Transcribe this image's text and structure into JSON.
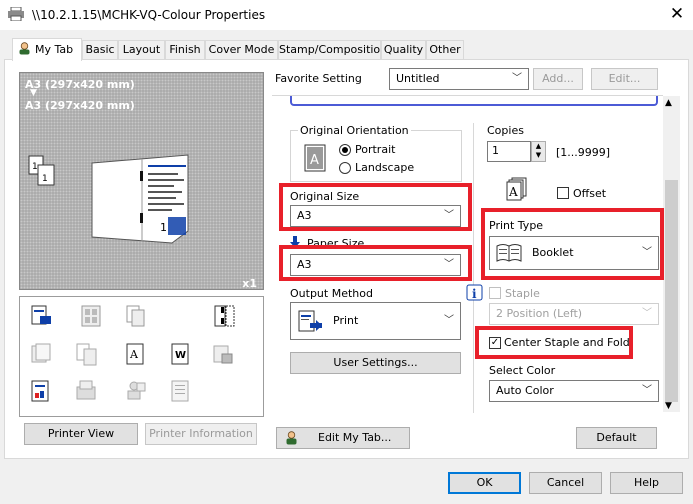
{
  "window": {
    "title": "\\\\10.2.1.15\\MCHK-VQ-Colour Properties",
    "close_glyph": "✕"
  },
  "tabs": [
    {
      "label": "My Tab"
    },
    {
      "label": "Basic"
    },
    {
      "label": "Layout"
    },
    {
      "label": "Finish"
    },
    {
      "label": "Cover Mode"
    },
    {
      "label": "Stamp/Composition"
    },
    {
      "label": "Quality"
    },
    {
      "label": "Other"
    }
  ],
  "favorite": {
    "label": "Favorite Setting",
    "value": "Untitled",
    "add_label": "Add...",
    "edit_label": "Edit..."
  },
  "preview": {
    "line1": "A3 (297x420 mm)",
    "arrow": "▼",
    "line2": "A3 (297x420 mm)",
    "copies_badge": "x1"
  },
  "left_buttons": {
    "printer_view": "Printer View",
    "printer_info": "Printer Information"
  },
  "orientation": {
    "label": "Original Orientation",
    "portrait": "Portrait",
    "landscape": "Landscape",
    "selected": "Portrait"
  },
  "original_size": {
    "label": "Original Size",
    "value": "A3"
  },
  "paper_size": {
    "label": "Paper Size",
    "value": "A3"
  },
  "output_method": {
    "label": "Output Method",
    "value": "Print"
  },
  "user_settings_label": "User Settings...",
  "copies": {
    "label": "Copies",
    "value": "1",
    "range": "[1...9999]"
  },
  "offset": {
    "label": "Offset",
    "checked": false
  },
  "print_type": {
    "label": "Print Type",
    "value": "Booklet"
  },
  "staple": {
    "label": "Staple",
    "value": "2 Position (Left)",
    "checked": false,
    "enabled": false
  },
  "center_staple": {
    "label": "Center Staple and Fold",
    "checked": true
  },
  "select_color": {
    "label": "Select Color",
    "value": "Auto Color"
  },
  "bottom": {
    "edit_my_tab": "Edit My Tab...",
    "default": "Default",
    "ok": "OK",
    "cancel": "Cancel",
    "help": "Help"
  },
  "colors": {
    "highlight": "#e8202a",
    "accent_blue": "#0e3fa8",
    "ok_border": "#0078d7"
  },
  "icons": [
    "printer-icon",
    "user-icon",
    "info-icon",
    "booklet-icon",
    "copies-icon"
  ]
}
